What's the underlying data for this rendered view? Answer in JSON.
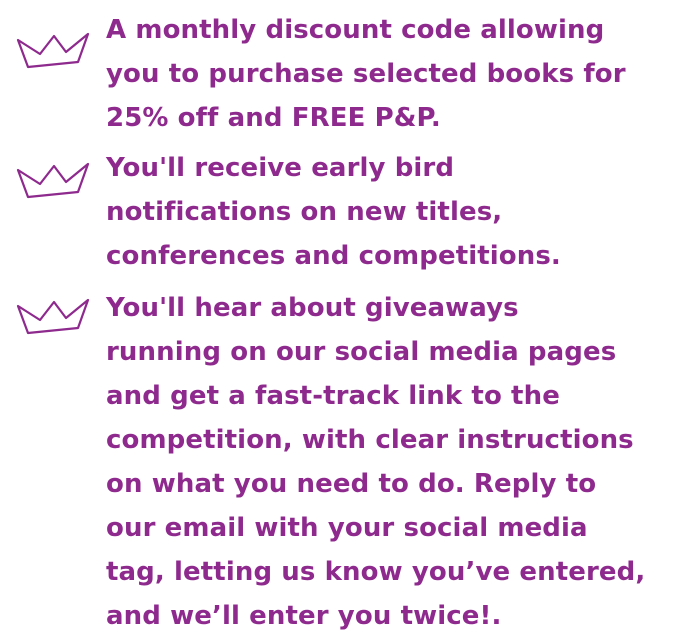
{
  "colors": {
    "text": "#8e2a8e",
    "crown_stroke": "#8e2a8e",
    "background": "#ffffff"
  },
  "benefits": [
    {
      "icon": "crown-icon",
      "lines": [
        "A monthly discount code allowing",
        "you to purchase selected books for",
        "25% off and FREE P&P."
      ]
    },
    {
      "icon": "crown-icon",
      "lines": [
        "You'll receive early bird",
        "notifications on new titles,",
        "conferences and competitions."
      ]
    },
    {
      "icon": "crown-icon",
      "lines": [
        "You'll hear about giveaways",
        "running on our social media pages",
        "and get a fast-track link to the",
        "competition, with clear instructions",
        "on what you need to do. Reply to",
        "our email with your social media",
        "tag, letting us know you’ve entered,",
        "and we’ll enter you twice!."
      ]
    }
  ]
}
